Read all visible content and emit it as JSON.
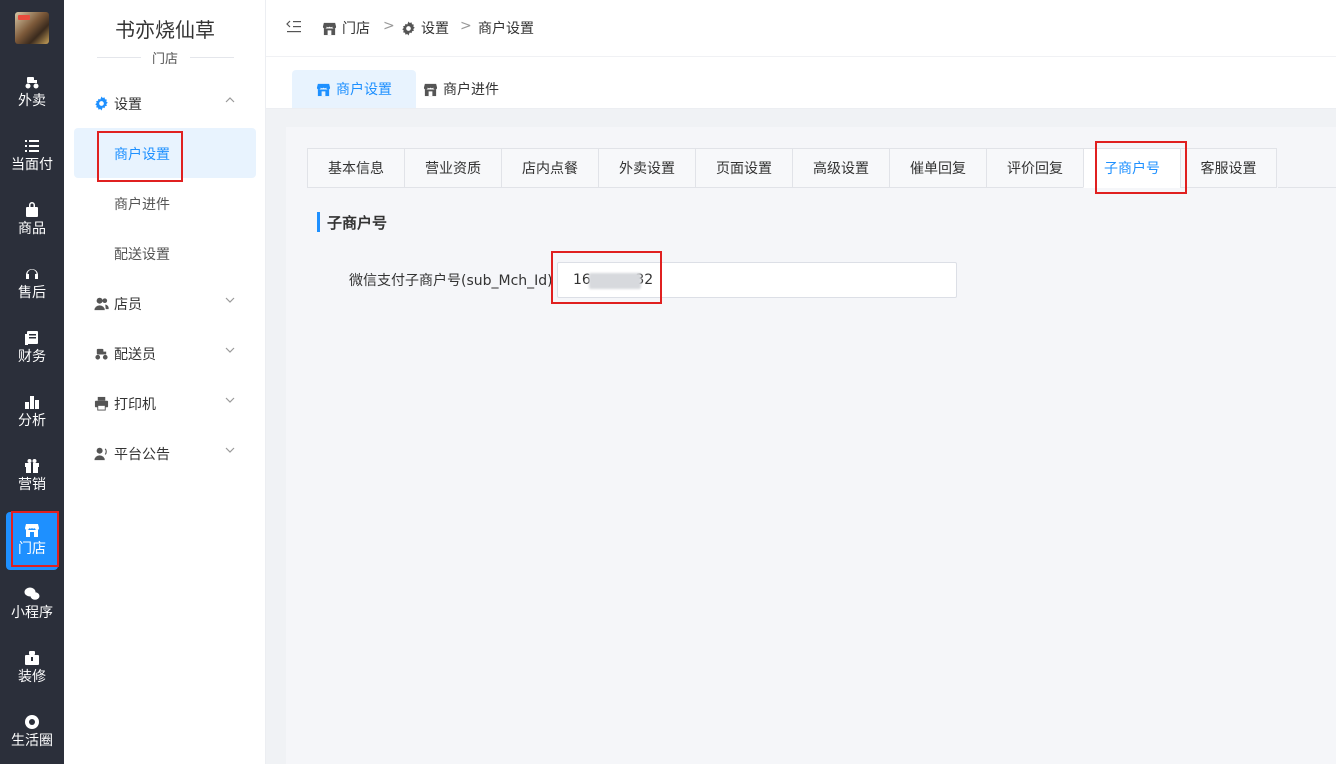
{
  "rail": {
    "items": [
      {
        "label": "外卖",
        "icon": "scooter-icon"
      },
      {
        "label": "当面付",
        "icon": "list-icon"
      },
      {
        "label": "商品",
        "icon": "bag-icon"
      },
      {
        "label": "售后",
        "icon": "headset-icon"
      },
      {
        "label": "财务",
        "icon": "ledger-icon"
      },
      {
        "label": "分析",
        "icon": "bar-chart-icon"
      },
      {
        "label": "营销",
        "icon": "gift-icon"
      },
      {
        "label": "门店",
        "icon": "store-icon"
      },
      {
        "label": "小程序",
        "icon": "wechat-icon"
      },
      {
        "label": "装修",
        "icon": "toolbox-icon"
      },
      {
        "label": "生活圈",
        "icon": "lifebuoy-icon"
      }
    ],
    "active_index": 7,
    "active_color": "#1e90ff"
  },
  "sidebar": {
    "store_name": "书亦烧仙草",
    "store_sub": "门店",
    "groups": [
      {
        "label": "设置",
        "icon": "gear-icon",
        "expanded": true
      },
      {
        "label": "店员",
        "icon": "staff-icon",
        "expanded": false
      },
      {
        "label": "配送员",
        "icon": "scooter-icon",
        "expanded": false
      },
      {
        "label": "打印机",
        "icon": "printer-icon",
        "expanded": false
      },
      {
        "label": "平台公告",
        "icon": "announce-icon",
        "expanded": false
      }
    ],
    "settings_items": [
      "商户设置",
      "商户进件",
      "配送设置"
    ],
    "active_item": "商户设置"
  },
  "breadcrumb": {
    "items": [
      "门店",
      "设置",
      "商户设置"
    ],
    "separator": ">"
  },
  "page_tabs": {
    "items": [
      "商户设置",
      "商户进件"
    ],
    "active": "商户设置"
  },
  "content_tabs": {
    "items": [
      "基本信息",
      "营业资质",
      "店内点餐",
      "外卖设置",
      "页面设置",
      "高级设置",
      "催单回复",
      "评价回复",
      "子商户号",
      "客服设置"
    ],
    "active": "子商户号"
  },
  "section": {
    "title": "子商户号",
    "field_label": "微信支付子商户号(sub_Mch_Id)",
    "field_value": "16          32"
  },
  "colors": {
    "accent": "#1e90ff",
    "highlight_box": "#e02020",
    "rail_bg": "#2b2f3a"
  }
}
